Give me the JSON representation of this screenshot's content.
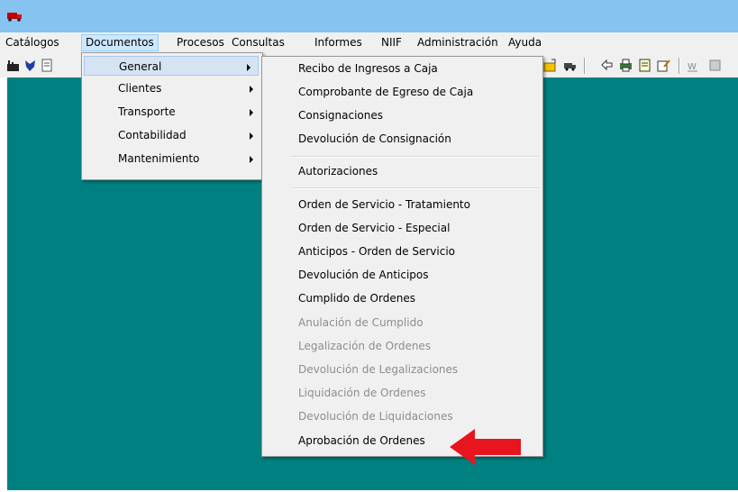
{
  "menubar": {
    "items": [
      "Catálogos",
      "Documentos",
      "Procesos",
      "Consultas",
      "Informes",
      "NIIF",
      "Administración",
      "Ayuda"
    ]
  },
  "toolbar": {
    "left_icons": [
      "factory-icon",
      "shield-icon",
      "document-icon"
    ],
    "right_icons": [
      "folder-new-icon",
      "truck-icon",
      "swap-icon",
      "printer-icon",
      "notepad-icon",
      "edit-icon",
      "word-icon",
      "settings-icon"
    ]
  },
  "documentos_menu": {
    "items": [
      {
        "label": "General",
        "submenu": true,
        "selected": true
      },
      {
        "label": "Clientes",
        "submenu": true
      },
      {
        "label": "Transporte",
        "submenu": true
      },
      {
        "label": "Contabilidad",
        "submenu": true
      },
      {
        "label": "Mantenimiento",
        "submenu": true
      }
    ]
  },
  "general_menu": {
    "group1": [
      {
        "label": "Recibo de Ingresos a Caja",
        "enabled": true
      },
      {
        "label": "Comprobante de Egreso de Caja",
        "enabled": true
      },
      {
        "label": "Consignaciones",
        "enabled": true
      },
      {
        "label": "Devolución de Consignación",
        "enabled": true
      }
    ],
    "group2": [
      {
        "label": "Autorizaciones",
        "enabled": true
      }
    ],
    "group3": [
      {
        "label": "Orden de Servicio - Tratamiento",
        "enabled": true
      },
      {
        "label": "Orden de Servicio - Especial",
        "enabled": true
      },
      {
        "label": "Anticipos - Orden de Servicio",
        "enabled": true
      },
      {
        "label": "Devolución de Anticipos",
        "enabled": true
      },
      {
        "label": "Cumplido de Ordenes",
        "enabled": true
      },
      {
        "label": "Anulación de Cumplido",
        "enabled": false
      },
      {
        "label": "Legalización de Ordenes",
        "enabled": false
      },
      {
        "label": "Devolución de Legalizaciones",
        "enabled": false
      },
      {
        "label": "Liquidación de Ordenes",
        "enabled": false
      },
      {
        "label": "Devolución de Liquidaciones",
        "enabled": false
      },
      {
        "label": "Aprobación de Ordenes",
        "enabled": true
      }
    ]
  },
  "colors": {
    "titlebar": "#87c3f0",
    "workspace": "#008080",
    "menu_bg": "#f0f0f0",
    "highlight": "#cce8ff",
    "arrow": "#e8141e"
  }
}
